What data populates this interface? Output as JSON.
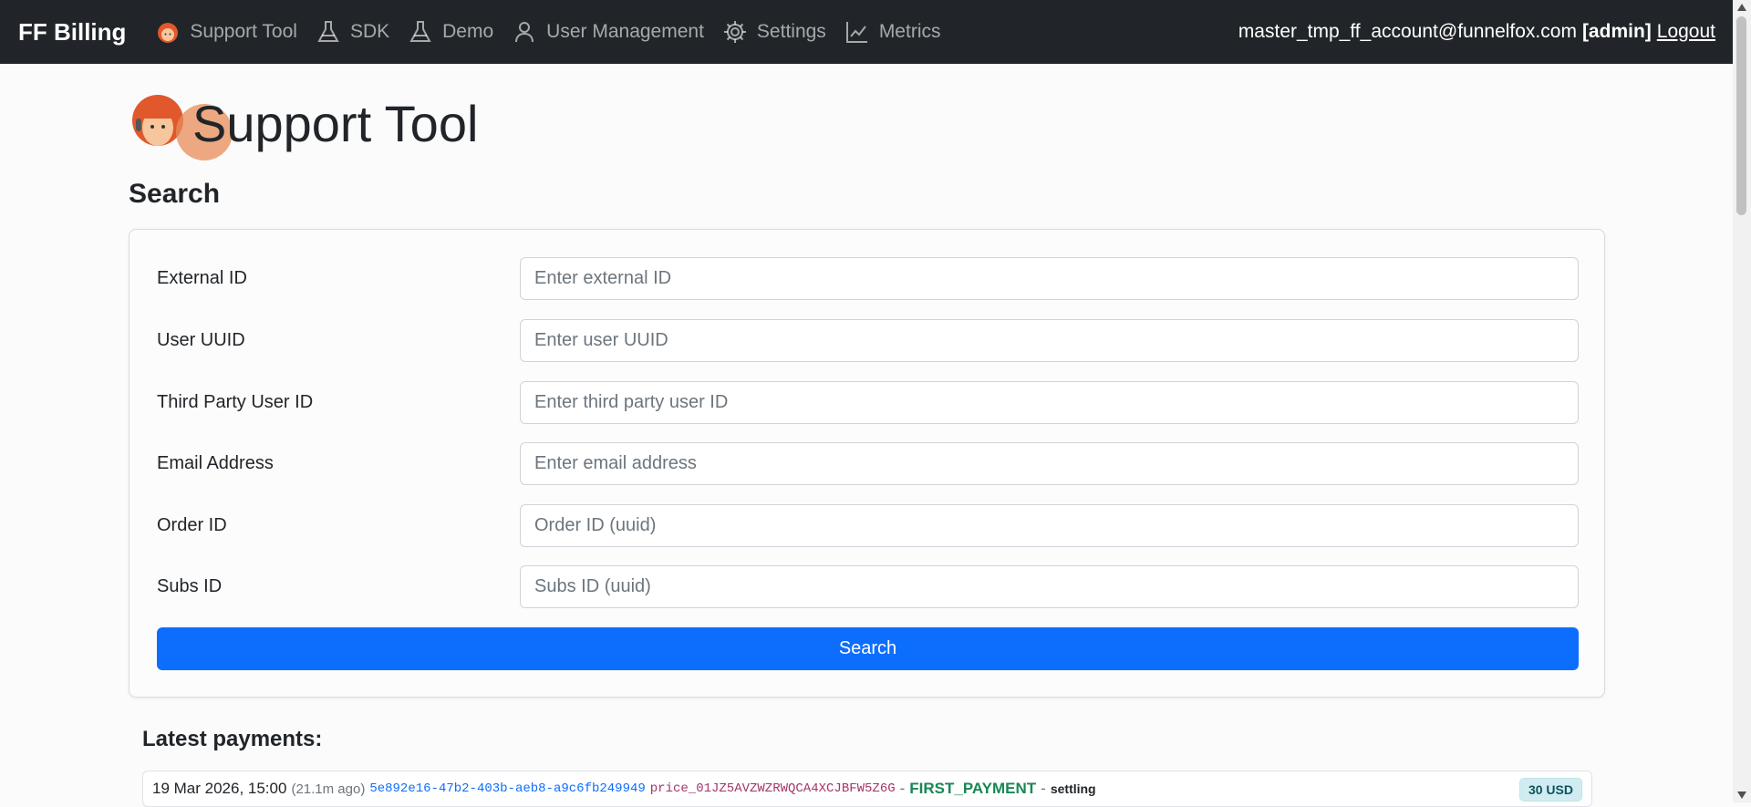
{
  "navbar": {
    "brand": "FF Billing",
    "items": [
      {
        "label": "Support Tool",
        "icon": "support-agent-icon"
      },
      {
        "label": "SDK",
        "icon": "flask-icon"
      },
      {
        "label": "Demo",
        "icon": "flask-icon"
      },
      {
        "label": "User Management",
        "icon": "person-icon"
      },
      {
        "label": "Settings",
        "icon": "gear-icon"
      },
      {
        "label": "Metrics",
        "icon": "chart-line-icon"
      }
    ],
    "user_email": "master_tmp_ff_account@funnelfox.com",
    "user_role": "[admin]",
    "logout_label": "Logout"
  },
  "page": {
    "title": "Support Tool",
    "search_section_title": "Search"
  },
  "form": {
    "fields": [
      {
        "label": "External ID",
        "placeholder": "Enter external ID",
        "value": ""
      },
      {
        "label": "User UUID",
        "placeholder": "Enter user UUID",
        "value": ""
      },
      {
        "label": "Third Party User ID",
        "placeholder": "Enter third party user ID",
        "value": ""
      },
      {
        "label": "Email Address",
        "placeholder": "Enter email address",
        "value": ""
      },
      {
        "label": "Order ID",
        "placeholder": "Order ID (uuid)",
        "value": ""
      },
      {
        "label": "Subs ID",
        "placeholder": "Subs ID (uuid)",
        "value": ""
      }
    ],
    "search_button_label": "Search"
  },
  "payments": {
    "title": "Latest payments:",
    "items": [
      {
        "date": "19 Mar 2026, 15:00",
        "ago": "(21.1m ago)",
        "id": "5e892e16-47b2-403b-aeb8-a9c6fb249949",
        "price_id": "price_01JZ5AVZWZRWQCA4XCJBFW5Z6G",
        "separator": "-",
        "type": "FIRST_PAYMENT",
        "status": "settling",
        "amount": "30 USD"
      }
    ]
  },
  "colors": {
    "navbar_bg": "#212529",
    "primary": "#0d6efd",
    "success": "#198754"
  }
}
